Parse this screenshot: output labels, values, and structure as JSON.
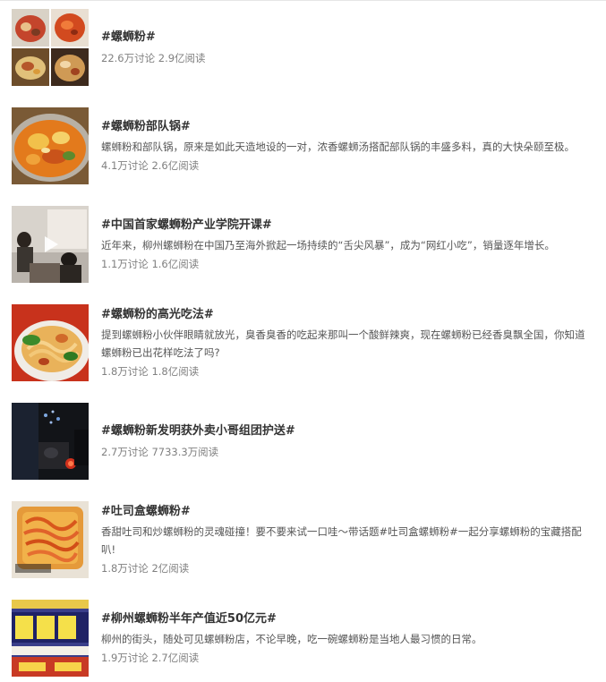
{
  "topics": [
    {
      "title": "#螺蛳粉#",
      "desc": "",
      "stats": "22.6万讨论 2.9亿阅读",
      "thumb_icon": "food-collage-image"
    },
    {
      "title": "#螺蛳粉部队锅#",
      "desc": "螺蛳粉和部队锅，原来是如此天造地设的一对，浓香螺蛳汤搭配部队锅的丰盛多料，真的大快朵颐至极。",
      "stats": "4.1万讨论 2.6亿阅读",
      "thumb_icon": "hotpot-image"
    },
    {
      "title": "#中国首家螺蛳粉产业学院开课#",
      "desc": "近年来，柳州螺蛳粉在中国乃至海外掀起一场持续的“舌尖风暴”，成为“网红小吃”，销量逐年增长。",
      "stats": "1.1万讨论 1.6亿阅读",
      "thumb_icon": "video-play-icon"
    },
    {
      "title": "#螺蛳粉的高光吃法#",
      "desc": "提到螺蛳粉小伙伴眼睛就放光，臭香臭香的吃起来那叫一个酸鲜辣爽，现在螺蛳粉已经香臭飘全国，你知道螺蛳粉已出花样吃法了吗?",
      "stats": "1.8万讨论 1.8亿阅读",
      "thumb_icon": "noodle-bowl-image"
    },
    {
      "title": "#螺蛳粉新发明获外卖小哥组团护送#",
      "desc": "",
      "stats": "2.7万讨论 7733.3万阅读",
      "thumb_icon": "night-street-image"
    },
    {
      "title": "#吐司盒螺蛳粉#",
      "desc": "香甜吐司和炒螺蛳粉的灵魂碰撞！要不要来试一口哇～带话题#吐司盒螺蛳粉#一起分享螺蛳粉的宝藏搭配叭!",
      "stats": "1.8万讨论 2亿阅读",
      "thumb_icon": "toast-noodle-image"
    },
    {
      "title": "#柳州螺蛳粉半年产值近50亿元#",
      "desc": "柳州的街头，随处可见螺蛳粉店，不论早晚，吃一碗螺蛳粉是当地人最习惯的日常。",
      "stats": "1.9万讨论 2.7亿阅读",
      "thumb_icon": "shop-sign-image"
    }
  ]
}
